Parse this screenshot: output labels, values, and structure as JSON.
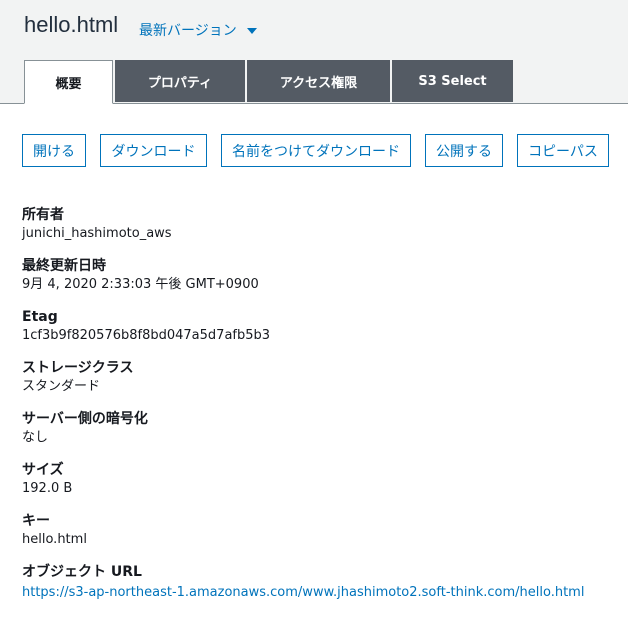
{
  "header": {
    "title": "hello.html",
    "version_label": "最新バージョン"
  },
  "tabs": [
    {
      "label": "概要",
      "active": true
    },
    {
      "label": "プロパティ",
      "active": false
    },
    {
      "label": "アクセス権限",
      "active": false
    },
    {
      "label": "S3 Select",
      "active": false
    }
  ],
  "actions": {
    "open": "開ける",
    "download": "ダウンロード",
    "download_as": "名前をつけてダウンロード",
    "make_public": "公開する",
    "copy_path": "コピーパス"
  },
  "properties": {
    "owner": {
      "label": "所有者",
      "value": "junichi_hashimoto_aws"
    },
    "last_modified": {
      "label": "最終更新日時",
      "value": "9月 4, 2020 2:33:03 午後 GMT+0900"
    },
    "etag": {
      "label": "Etag",
      "value": "1cf3b9f820576b8f8bd047a5d7afb5b3"
    },
    "storage_class": {
      "label": "ストレージクラス",
      "value": "スタンダード"
    },
    "encryption": {
      "label": "サーバー側の暗号化",
      "value": "なし"
    },
    "size": {
      "label": "サイズ",
      "value": "192.0 B"
    },
    "key": {
      "label": "キー",
      "value": "hello.html"
    },
    "object_url": {
      "label": "オブジェクト URL",
      "value": "https://s3-ap-northeast-1.amazonaws.com/www.jhashimoto2.soft-think.com/hello.html"
    }
  },
  "colors": {
    "link": "#0073bb",
    "tab_inactive": "#545b64",
    "header_bg": "#f2f3f3"
  }
}
